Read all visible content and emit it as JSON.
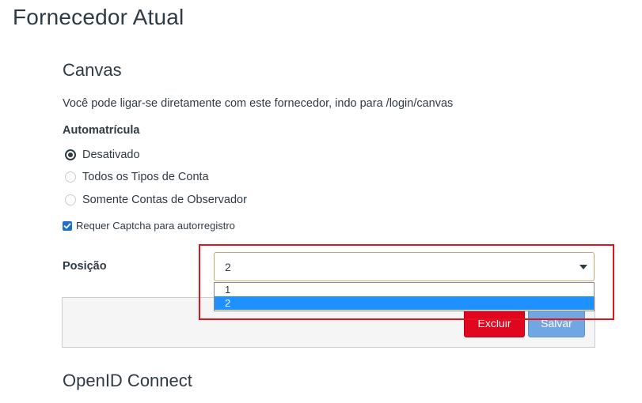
{
  "page": {
    "title": "Fornecedor Atual"
  },
  "canvas_section": {
    "title": "Canvas",
    "description": "Você pode ligar-se diretamente com este fornecedor, indo para /login/canvas",
    "automatricula_label": "Automatrícula",
    "radio_options": [
      {
        "label": "Desativado",
        "checked": true
      },
      {
        "label": "Todos os Tipos de Conta",
        "checked": false
      },
      {
        "label": "Somente Contas de Observador",
        "checked": false
      }
    ],
    "captcha_checkbox": {
      "label": "Requer Captcha para autorregistro",
      "checked": true
    },
    "posicao_label": "Posição",
    "posicao_select": {
      "value": "2",
      "options": [
        "1",
        "2"
      ],
      "selected_option": "2"
    },
    "buttons": {
      "delete_label": "Excluir",
      "save_label": "Salvar"
    }
  },
  "openid_section": {
    "title": "OpenID Connect"
  },
  "colors": {
    "text": "#2d3b45",
    "delete": "#e0061f",
    "save": "#70a6e2",
    "selected_option": "#1e90ff",
    "highlight": "#e3131b"
  }
}
